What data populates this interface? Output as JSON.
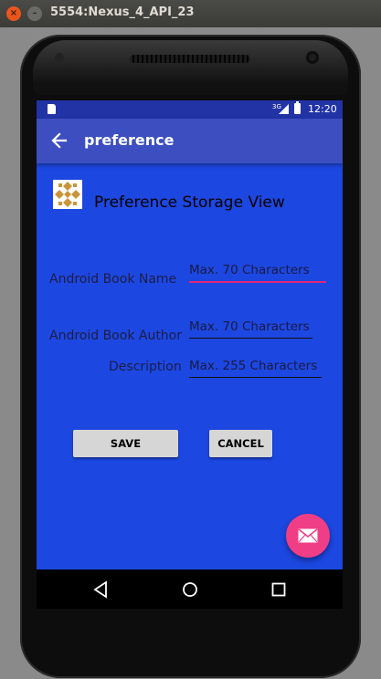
{
  "window": {
    "title": "5554:Nexus_4_API_23",
    "close_glyph": "×",
    "minimize_glyph": "–"
  },
  "status_bar": {
    "network": "3G",
    "time": "12:20"
  },
  "app_bar": {
    "title": "preference",
    "back_icon": "arrow-back-icon"
  },
  "main": {
    "heading": "Preference Storage View",
    "logo_icon": "ornament-logo-icon",
    "fields": [
      {
        "label": "Android Book Name",
        "placeholder": "Max. 70 Characters",
        "focused": true
      },
      {
        "label": "Android Book Author",
        "placeholder": "Max. 70 Characters",
        "focused": false
      },
      {
        "label": "Description",
        "placeholder": "Max. 255 Characters",
        "focused": false
      }
    ],
    "save_label": "SAVE",
    "cancel_label": "CANCEL"
  },
  "fab": {
    "icon": "mail-icon"
  },
  "colors": {
    "screen_bg": "#1c47e0",
    "status_bar": "#2233a6",
    "app_bar": "#3d4fc0",
    "accent": "#f03e86",
    "focus_line": "#e0257a"
  }
}
